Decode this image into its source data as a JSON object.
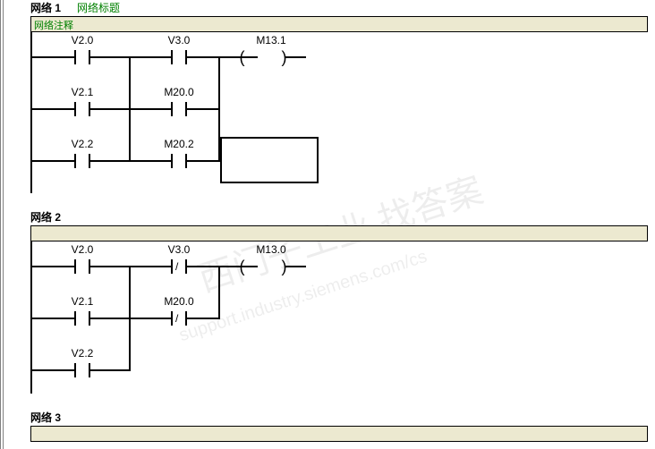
{
  "networks": {
    "net1": {
      "label": "网络 1",
      "title": "网络标题",
      "comment": "网络注释",
      "contacts": {
        "c_v20": "V2.0",
        "c_v30": "V3.0",
        "c_v21": "V2.1",
        "c_m200": "M20.0",
        "c_v22": "V2.2",
        "c_m202": "M20.2"
      },
      "coils": {
        "m131": "M13.1"
      }
    },
    "net2": {
      "label": "网络 2",
      "comment": "",
      "contacts": {
        "c_v20": "V2.0",
        "c_v30": "V3.0",
        "c_v21": "V2.1",
        "c_m200": "M20.0",
        "c_v22": "V2.2"
      },
      "coils": {
        "m130": "M13.0"
      }
    },
    "net3": {
      "label": "网络 3",
      "comment": ""
    }
  },
  "watermark": {
    "text1": "西门子工业  找答案",
    "text2": "support.industry.siemens.com/cs"
  }
}
